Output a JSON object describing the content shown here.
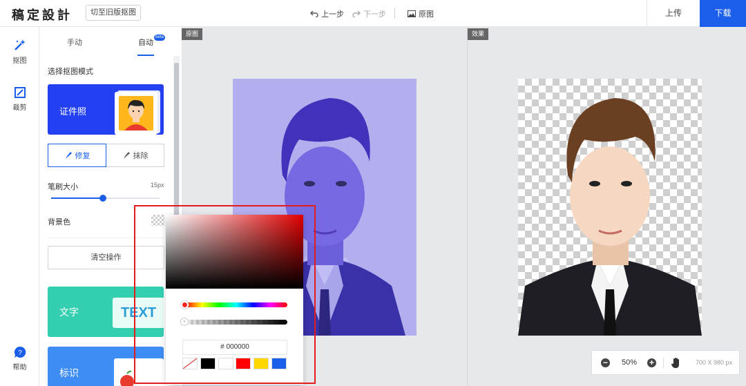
{
  "header": {
    "logo": "稿定設計",
    "old_version_button": "切至旧版抠图",
    "undo_label": "上一步",
    "redo_label": "下一步",
    "original_label": "原图",
    "upload_label": "上传",
    "download_label": "下载"
  },
  "left_nav": {
    "items": [
      {
        "label": "抠图",
        "icon": "magic-wand-icon",
        "active": true
      },
      {
        "label": "裁剪",
        "icon": "crop-icon",
        "active": false
      }
    ],
    "help_label": "帮助"
  },
  "panel": {
    "tabs": [
      {
        "label": "手动",
        "active": false
      },
      {
        "label": "自动",
        "active": true,
        "badge": "beta"
      }
    ],
    "mode_title": "选择抠图模式",
    "id_photo_label": "证件照",
    "repair_label": "修复",
    "erase_label": "抹除",
    "brush_size_label": "笔刷大小",
    "brush_size_value": "15px",
    "brush_size_fraction": 0.47,
    "bg_color_label": "背景色",
    "clear_label": "清空操作",
    "text_card_label": "文字",
    "text_card_sample": "TEXT",
    "mark_card_label": "标识"
  },
  "canvas": {
    "original_tag": "原图",
    "result_tag": "效果",
    "zoom": "50%",
    "dimensions": "700 X 980 px"
  },
  "color_picker": {
    "hex_value": "# 000000",
    "presets": [
      "none",
      "#000000",
      "#ffffff",
      "#ff0000",
      "#ffd700",
      "#1b5eea"
    ]
  },
  "colors": {
    "accent": "#1b5eea",
    "highlight_border": "#e31b1b",
    "id_card_bg": "#2340f2",
    "text_card_bg": "#34cfb0",
    "mark_card_bg": "#3d8df5"
  }
}
